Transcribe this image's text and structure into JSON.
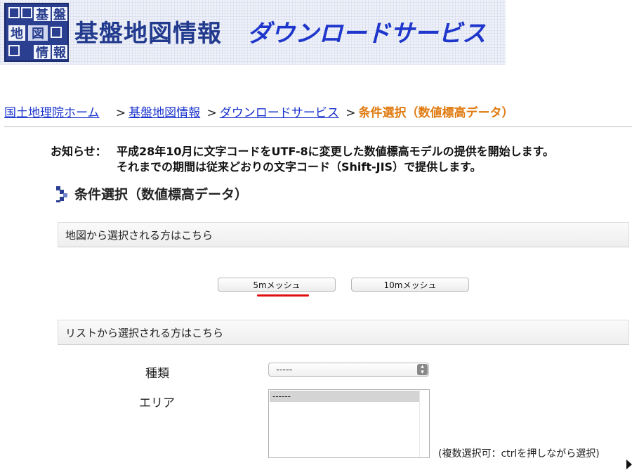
{
  "header": {
    "logo": {
      "cells": [
        "基",
        "盤",
        "地",
        "図",
        "情",
        "報"
      ]
    },
    "title": "基盤地図情報",
    "subtitle": "ダウンロードサービス"
  },
  "breadcrumb": {
    "items": [
      "国土地理院ホーム",
      "基盤地図情報",
      "ダウンロードサービス"
    ],
    "separator": ">",
    "current": "条件選択（数値標高データ）"
  },
  "notice": {
    "label": "お知らせ：",
    "line1": "平成28年10月に文字コードをUTF-8に変更した数値標高モデルの提供を開始します。",
    "line2": "それまでの期間は従来どおりの文字コード（Shift-JIS）で提供します。"
  },
  "section": {
    "title": "条件選択（数値標高データ）"
  },
  "map_panel": {
    "title": "地図から選択される方はこちら",
    "buttons": [
      "5mメッシュ",
      "10mメッシュ"
    ]
  },
  "list_panel": {
    "title": "リストから選択される方はこちら",
    "type_label": "種類",
    "type_value": "-----",
    "area_label": "エリア",
    "area_options": [
      "------"
    ],
    "hint": "(複数選択可：ctrlを押しながら選択)"
  },
  "colors": {
    "link": "#1a33cc",
    "current": "#e07a10",
    "brand": "#2a3f8f",
    "highlight": "#e01010"
  }
}
